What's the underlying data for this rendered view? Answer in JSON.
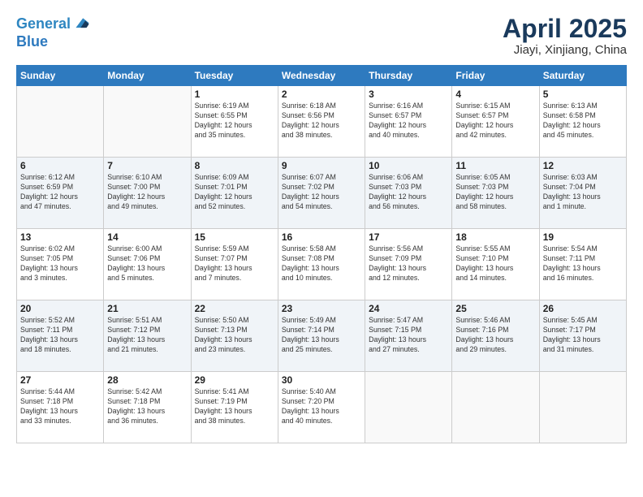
{
  "header": {
    "logo_line1": "General",
    "logo_line2": "Blue",
    "main_title": "April 2025",
    "subtitle": "Jiayi, Xinjiang, China"
  },
  "weekdays": [
    "Sunday",
    "Monday",
    "Tuesday",
    "Wednesday",
    "Thursday",
    "Friday",
    "Saturday"
  ],
  "weeks": [
    [
      {
        "day": "",
        "info": ""
      },
      {
        "day": "",
        "info": ""
      },
      {
        "day": "1",
        "info": "Sunrise: 6:19 AM\nSunset: 6:55 PM\nDaylight: 12 hours\nand 35 minutes."
      },
      {
        "day": "2",
        "info": "Sunrise: 6:18 AM\nSunset: 6:56 PM\nDaylight: 12 hours\nand 38 minutes."
      },
      {
        "day": "3",
        "info": "Sunrise: 6:16 AM\nSunset: 6:57 PM\nDaylight: 12 hours\nand 40 minutes."
      },
      {
        "day": "4",
        "info": "Sunrise: 6:15 AM\nSunset: 6:57 PM\nDaylight: 12 hours\nand 42 minutes."
      },
      {
        "day": "5",
        "info": "Sunrise: 6:13 AM\nSunset: 6:58 PM\nDaylight: 12 hours\nand 45 minutes."
      }
    ],
    [
      {
        "day": "6",
        "info": "Sunrise: 6:12 AM\nSunset: 6:59 PM\nDaylight: 12 hours\nand 47 minutes."
      },
      {
        "day": "7",
        "info": "Sunrise: 6:10 AM\nSunset: 7:00 PM\nDaylight: 12 hours\nand 49 minutes."
      },
      {
        "day": "8",
        "info": "Sunrise: 6:09 AM\nSunset: 7:01 PM\nDaylight: 12 hours\nand 52 minutes."
      },
      {
        "day": "9",
        "info": "Sunrise: 6:07 AM\nSunset: 7:02 PM\nDaylight: 12 hours\nand 54 minutes."
      },
      {
        "day": "10",
        "info": "Sunrise: 6:06 AM\nSunset: 7:03 PM\nDaylight: 12 hours\nand 56 minutes."
      },
      {
        "day": "11",
        "info": "Sunrise: 6:05 AM\nSunset: 7:03 PM\nDaylight: 12 hours\nand 58 minutes."
      },
      {
        "day": "12",
        "info": "Sunrise: 6:03 AM\nSunset: 7:04 PM\nDaylight: 13 hours\nand 1 minute."
      }
    ],
    [
      {
        "day": "13",
        "info": "Sunrise: 6:02 AM\nSunset: 7:05 PM\nDaylight: 13 hours\nand 3 minutes."
      },
      {
        "day": "14",
        "info": "Sunrise: 6:00 AM\nSunset: 7:06 PM\nDaylight: 13 hours\nand 5 minutes."
      },
      {
        "day": "15",
        "info": "Sunrise: 5:59 AM\nSunset: 7:07 PM\nDaylight: 13 hours\nand 7 minutes."
      },
      {
        "day": "16",
        "info": "Sunrise: 5:58 AM\nSunset: 7:08 PM\nDaylight: 13 hours\nand 10 minutes."
      },
      {
        "day": "17",
        "info": "Sunrise: 5:56 AM\nSunset: 7:09 PM\nDaylight: 13 hours\nand 12 minutes."
      },
      {
        "day": "18",
        "info": "Sunrise: 5:55 AM\nSunset: 7:10 PM\nDaylight: 13 hours\nand 14 minutes."
      },
      {
        "day": "19",
        "info": "Sunrise: 5:54 AM\nSunset: 7:11 PM\nDaylight: 13 hours\nand 16 minutes."
      }
    ],
    [
      {
        "day": "20",
        "info": "Sunrise: 5:52 AM\nSunset: 7:11 PM\nDaylight: 13 hours\nand 18 minutes."
      },
      {
        "day": "21",
        "info": "Sunrise: 5:51 AM\nSunset: 7:12 PM\nDaylight: 13 hours\nand 21 minutes."
      },
      {
        "day": "22",
        "info": "Sunrise: 5:50 AM\nSunset: 7:13 PM\nDaylight: 13 hours\nand 23 minutes."
      },
      {
        "day": "23",
        "info": "Sunrise: 5:49 AM\nSunset: 7:14 PM\nDaylight: 13 hours\nand 25 minutes."
      },
      {
        "day": "24",
        "info": "Sunrise: 5:47 AM\nSunset: 7:15 PM\nDaylight: 13 hours\nand 27 minutes."
      },
      {
        "day": "25",
        "info": "Sunrise: 5:46 AM\nSunset: 7:16 PM\nDaylight: 13 hours\nand 29 minutes."
      },
      {
        "day": "26",
        "info": "Sunrise: 5:45 AM\nSunset: 7:17 PM\nDaylight: 13 hours\nand 31 minutes."
      }
    ],
    [
      {
        "day": "27",
        "info": "Sunrise: 5:44 AM\nSunset: 7:18 PM\nDaylight: 13 hours\nand 33 minutes."
      },
      {
        "day": "28",
        "info": "Sunrise: 5:42 AM\nSunset: 7:18 PM\nDaylight: 13 hours\nand 36 minutes."
      },
      {
        "day": "29",
        "info": "Sunrise: 5:41 AM\nSunset: 7:19 PM\nDaylight: 13 hours\nand 38 minutes."
      },
      {
        "day": "30",
        "info": "Sunrise: 5:40 AM\nSunset: 7:20 PM\nDaylight: 13 hours\nand 40 minutes."
      },
      {
        "day": "",
        "info": ""
      },
      {
        "day": "",
        "info": ""
      },
      {
        "day": "",
        "info": ""
      }
    ]
  ]
}
